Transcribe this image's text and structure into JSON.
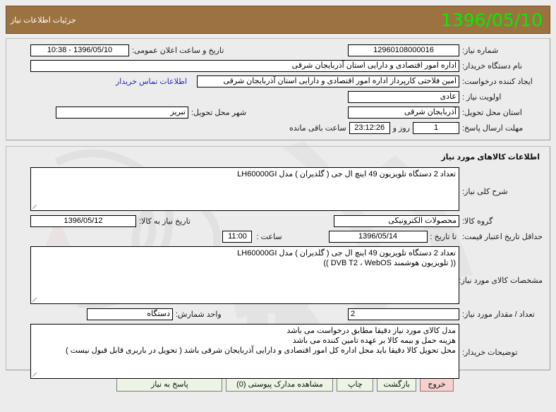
{
  "header": {
    "clock": "1396/05/10",
    "title": "جزئیات اطلاعات نیاز"
  },
  "need_info": {
    "need_number_label": "شماره نیاز:",
    "need_number_value": "12960108000016",
    "announce_datetime_label": "تاریخ و ساعت اعلان عمومی:",
    "announce_datetime_value": "1396/05/10 - 10:38",
    "buyer_org_label": "نام دستگاه خریدار:",
    "buyer_org_value": "اداره امور اقتصادی و دارایی استان آذربایجان شرقی",
    "requester_label": "ایجاد کننده درخواست:",
    "requester_value": "امین فلاحتی کارپرداز اداره امور اقتصادی و دارایی استان آذربایجان شرقی",
    "buyer_contact_link": "اطلاعات تماس خریدار",
    "priority_label": "اولویت نیاز :",
    "priority_value": "عادی",
    "province_label": "استان محل تحویل:",
    "province_value": "آذربایجان شرقی",
    "city_label": "شهر محل تحویل:",
    "city_value": "تبریز",
    "deadline_label": "مهلت ارسال پاسخ:",
    "deadline_days": "1",
    "deadline_days_suffix": "روز و",
    "deadline_time": "23:12:26",
    "deadline_time_suffix": "ساعت باقی مانده"
  },
  "goods": {
    "section_title": "اطلاعات کالاهای مورد نیاز",
    "description_label": "شرح کلی نیاز:",
    "description_value": "تعداد 2 دستگاه تلویزیون 49 اینچ ال جی ( گلدیران ) مدل LH60000GI",
    "group_label": "گروه کالا:",
    "group_value": "محصولات الکترونیکی",
    "need_date_label": "تاریخ نیاز به کالا:",
    "need_date_value": "1396/05/12",
    "validity_label": "حداقل تاریخ اعتبار قیمت:",
    "validity_until_label": "تا تاریخ :",
    "validity_until_value": "1396/05/14",
    "validity_time_label": "ساعت :",
    "validity_time_value": "11:00",
    "specs_label": "مشخصات کالای مورد نیاز:",
    "specs_value": "تعداد 2 دستگاه تلویزیون 49 اینچ ال جی ( گلدیران ) مدل LH60000GI\n(( تلویزیون هوشمند DVB T2 ، WebOS ))",
    "quantity_label": "تعداد / مقدار مورد نیاز:",
    "quantity_value": "2",
    "unit_label": "واحد شمارش:",
    "unit_value": "دستگاه",
    "buyer_notes_label": "توضیحات خریدار:",
    "buyer_notes_value": "مدل کالای مورد نیاز دقیقا مطابق درخواست می باشد\nهزینه حمل و بیمه کالا بر عهده تامین کننده می باشد\nمحل تحویل کالا دقیقا باید محل اداره کل امور اقتصادی و دارایی آذربایجان شرقی باشد ( تحویل در باربری قابل قبول نیست )"
  },
  "buttons": {
    "respond": "پاسخ به نیاز",
    "attachments": "مشاهده مدارک پیوستی (0)",
    "print": "چاپ",
    "back": "بازگشت",
    "exit": "خروج"
  },
  "colors": {
    "header_bg": "#9c7241",
    "clock_text": "#00ef00",
    "link": "#2626c8",
    "button_green": "#edf4e6",
    "button_danger": "#f6cfcf",
    "page_bg": "#ececec"
  }
}
